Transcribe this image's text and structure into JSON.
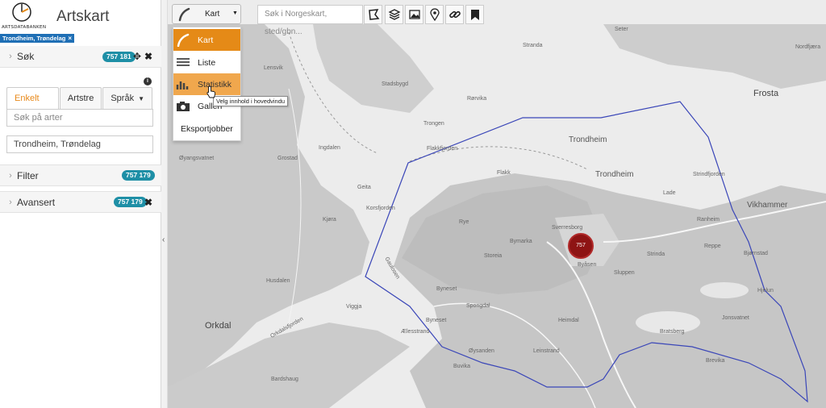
{
  "app": {
    "title": "Artskart",
    "logo_text": "ARTSDATABANKEN",
    "area_tag": "Trondheim, Trøndelag",
    "area_tag_close": "×"
  },
  "sidebar": {
    "search": {
      "label": "Søk",
      "count": "757 181"
    },
    "tabs": [
      {
        "label": "Enkelt søk"
      },
      {
        "label": "Artstre"
      },
      {
        "label": "Språk"
      }
    ],
    "species_input": {
      "placeholder": "Søk på arter"
    },
    "place_input": {
      "value": "Trondheim, Trøndelag"
    },
    "filter": {
      "label": "Filter",
      "count": "757 179"
    },
    "advanced": {
      "label": "Avansert",
      "count": "757 179"
    }
  },
  "toolbar": {
    "view_button_label": "Kart",
    "search_placeholder": "Søk i Norgeskart, sted/gbn...",
    "tools": [
      "polygon-icon",
      "layers-icon",
      "image-icon",
      "marker-icon",
      "link-icon",
      "bookmark-icon"
    ]
  },
  "view_menu": {
    "items": [
      {
        "label": "Kart",
        "icon": "map-line-icon",
        "state": "active"
      },
      {
        "label": "Liste",
        "icon": "list-icon",
        "state": "normal"
      },
      {
        "label": "Statistikk",
        "icon": "bar-chart-icon",
        "state": "hover"
      },
      {
        "label": "Galleri",
        "icon": "camera-icon",
        "state": "normal"
      },
      {
        "label": "Eksportjobber",
        "icon": "",
        "state": "normal"
      }
    ],
    "tooltip": "Velg innhold i hovedvindu"
  },
  "map": {
    "cluster_count": "757",
    "labels": {
      "seter": "Seter",
      "nordfjara": "Nordfjæra",
      "stranda": "Stranda",
      "lensvik": "Lensvik",
      "stadsbygd": "Stadsbygd",
      "rorvika": "Rørvika",
      "frosta": "Frosta",
      "trongen": "Trongen",
      "trondheim_sea": "Trondheim",
      "flakkfjorden": "Flakkfjorden",
      "ingdalen": "Ingdalen",
      "grostad": "Grostad",
      "flakk": "Flakk",
      "trondheim": "Trondheim",
      "strindfjorden": "Strindfjorden",
      "oyangsvatnet": "Øyangsvatnet",
      "geita": "Geita",
      "korsfjorden": "Korsfjorden",
      "lade": "Lade",
      "vikhammer": "Vikhammer",
      "kjora": "Kjøra",
      "rye": "Rye",
      "bymarka": "Bymarka",
      "sverresborg": "Sverresborg",
      "ranheim": "Ranheim",
      "storeia": "Storeia",
      "byasen": "Byåsen",
      "strinda": "Strinda",
      "reppe": "Reppe",
      "bjornstad": "Bjørnstad",
      "husdalen": "Husdalen",
      "gaulosen": "Gaulosen",
      "byneset": "Byneset",
      "sluppen": "Sluppen",
      "spongdal": "Spongdal",
      "hjelun": "Hjelun",
      "viggja": "Viggja",
      "orkdal": "Orkdal",
      "orkdalsfjorden": "Orkdalsfjorden",
      "byneset2": "Byneset",
      "heimdal": "Heimdal",
      "jonsvatnet": "Jonsvatnet",
      "aelesstrand": "Ælesstrand",
      "bratsberg": "Bratsberg",
      "leinstrand": "Leinstrand",
      "oysanden": "Øysanden",
      "brevika": "Brevika",
      "buvika": "Buvika",
      "bardshaug": "Bardshaug"
    }
  },
  "colors": {
    "accent": "#e58a17",
    "badge": "#1e8fa6",
    "area_tag": "#1f6fb5",
    "boundary": "#3a46b8",
    "cluster": "#8e1414"
  }
}
